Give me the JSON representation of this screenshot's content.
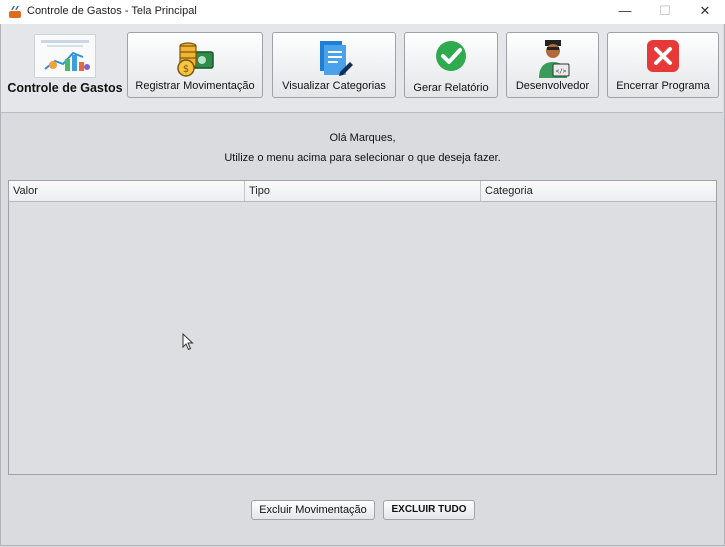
{
  "window": {
    "title": "Controle de Gastos - Tela Principal",
    "controls": {
      "minimize": "—",
      "maximize": "☐",
      "close": "✕"
    }
  },
  "toolbar": {
    "logo_caption": "Controle de Gastos",
    "buttons": [
      {
        "id": "registrar",
        "label": "Registrar Movimentação",
        "icon": "coins-cash-icon"
      },
      {
        "id": "visualizar",
        "label": "Visualizar Categorias",
        "icon": "document-edit-icon"
      },
      {
        "id": "relatorio",
        "label": "Gerar Relatório",
        "icon": "green-check-icon"
      },
      {
        "id": "desenvolvedor",
        "label": "Desenvolvedor",
        "icon": "developer-avatar-icon"
      },
      {
        "id": "encerrar",
        "label": "Encerrar Programa",
        "icon": "red-close-icon"
      }
    ]
  },
  "main": {
    "greeting": "Olá Marques,",
    "instruction": "Utilize o menu acima para selecionar o que deseja fazer."
  },
  "table": {
    "columns": [
      "Valor",
      "Tipo",
      "Categoria"
    ],
    "rows": []
  },
  "footer": {
    "delete_button": "Excluir Movimentação",
    "delete_all_button": "EXCLUIR TUDO"
  },
  "colors": {
    "check_green": "#2eab4f",
    "close_red": "#e8393a",
    "doc_blue": "#1f7fd6"
  }
}
